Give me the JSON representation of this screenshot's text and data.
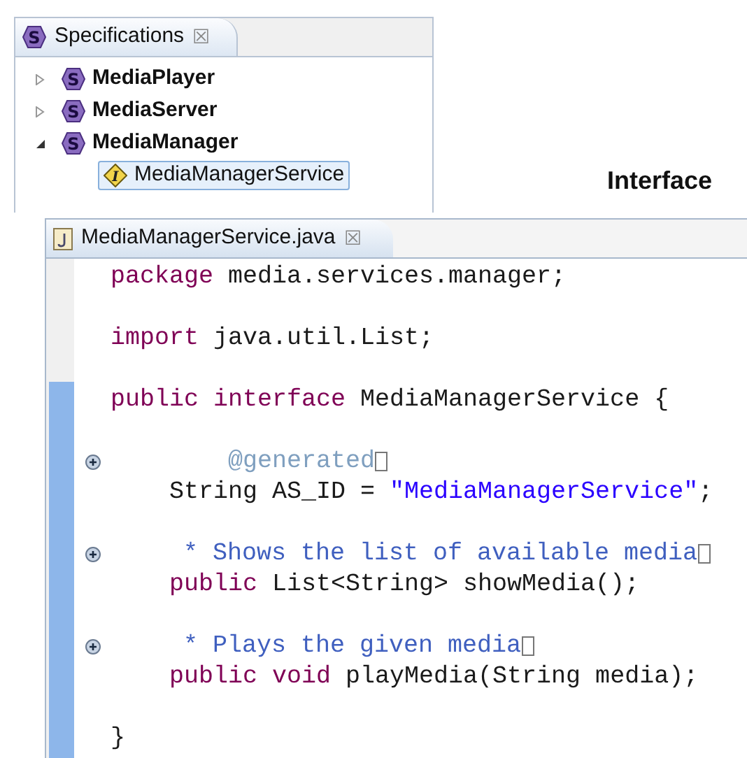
{
  "spec_view": {
    "tab": {
      "title": "Specifications",
      "close": "☒",
      "icon_letter": "S"
    },
    "tree": [
      {
        "label": "MediaPlayer",
        "kind": "spec",
        "icon_letter": "S",
        "expanded": false,
        "selected": false
      },
      {
        "label": "MediaServer",
        "kind": "spec",
        "icon_letter": "S",
        "expanded": false,
        "selected": false
      },
      {
        "label": "MediaManager",
        "kind": "spec",
        "icon_letter": "S",
        "expanded": true,
        "selected": false,
        "children": [
          {
            "label": "MediaManagerService",
            "kind": "interface",
            "icon_letter": "I",
            "selected": true
          }
        ]
      }
    ]
  },
  "caption": "Interface",
  "editor": {
    "tab": {
      "title": "MediaManagerService.java",
      "close": "☒"
    },
    "lines": [
      {
        "kind": "top",
        "tokens": [
          {
            "kind": "keyword",
            "text": "package"
          },
          {
            "kind": "plain",
            "text": " media.services.manager;"
          }
        ]
      },
      {
        "kind": "blank"
      },
      {
        "kind": "top",
        "tokens": [
          {
            "kind": "keyword",
            "text": "import"
          },
          {
            "kind": "plain",
            "text": " java.util.List;"
          }
        ]
      },
      {
        "kind": "blank"
      },
      {
        "kind": "top",
        "tokens": [
          {
            "kind": "keyword",
            "text": "public interface"
          },
          {
            "kind": "plain",
            "text": " MediaManagerService {"
          }
        ]
      },
      {
        "kind": "blank"
      },
      {
        "kind": "annotation",
        "foldable": true,
        "folded": true,
        "tokens": [
          {
            "kind": "annotation",
            "text": "@generated"
          }
        ]
      },
      {
        "kind": "member",
        "tokens": [
          {
            "kind": "plain",
            "text": "String AS_ID = "
          },
          {
            "kind": "string",
            "text": "\"MediaManagerService\""
          },
          {
            "kind": "plain",
            "text": ";"
          }
        ]
      },
      {
        "kind": "blank"
      },
      {
        "kind": "doc",
        "foldable": true,
        "folded": true,
        "tokens": [
          {
            "kind": "comment",
            "text": "* Shows the list of available media"
          }
        ]
      },
      {
        "kind": "member",
        "tokens": [
          {
            "kind": "keyword",
            "text": "public"
          },
          {
            "kind": "plain",
            "text": " List<String> showMedia();"
          }
        ]
      },
      {
        "kind": "blank"
      },
      {
        "kind": "doc",
        "foldable": true,
        "folded": true,
        "tokens": [
          {
            "kind": "comment",
            "text": "* Plays the given media"
          }
        ]
      },
      {
        "kind": "member",
        "tokens": [
          {
            "kind": "keyword",
            "text": "public void"
          },
          {
            "kind": "plain",
            "text": " playMedia(String media);"
          }
        ]
      },
      {
        "kind": "blank"
      },
      {
        "kind": "top",
        "tokens": [
          {
            "kind": "plain",
            "text": "}"
          }
        ]
      }
    ]
  }
}
